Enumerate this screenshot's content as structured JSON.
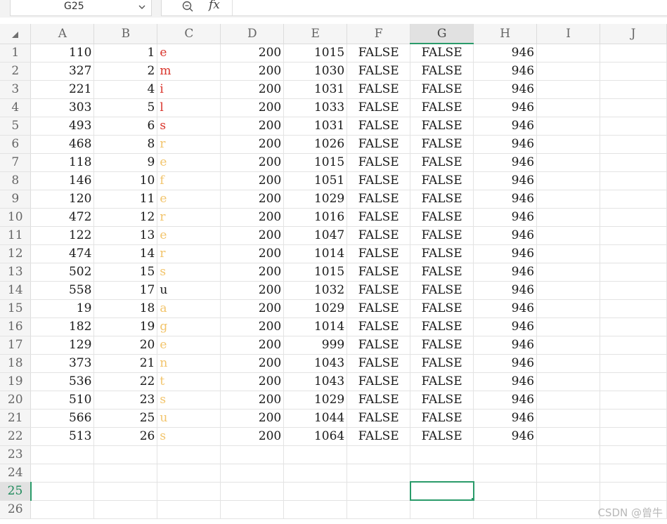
{
  "formula_bar": {
    "name_box": "G25",
    "fx_label": "fx",
    "formula_value": ""
  },
  "columns": [
    "A",
    "B",
    "C",
    "D",
    "E",
    "F",
    "G",
    "H",
    "I",
    "J"
  ],
  "selected_column": "G",
  "selected_row": 25,
  "rows": [
    {
      "row": 1,
      "A": "110",
      "B": "1",
      "C": "e",
      "D": "200",
      "E": "1015",
      "F": "FALSE",
      "G": "FALSE",
      "H": "946"
    },
    {
      "row": 2,
      "A": "327",
      "B": "2",
      "C": "m",
      "D": "200",
      "E": "1030",
      "F": "FALSE",
      "G": "FALSE",
      "H": "946"
    },
    {
      "row": 3,
      "A": "221",
      "B": "4",
      "C": "i",
      "D": "200",
      "E": "1031",
      "F": "FALSE",
      "G": "FALSE",
      "H": "946"
    },
    {
      "row": 4,
      "A": "303",
      "B": "5",
      "C": "l",
      "D": "200",
      "E": "1033",
      "F": "FALSE",
      "G": "FALSE",
      "H": "946"
    },
    {
      "row": 5,
      "A": "493",
      "B": "6",
      "C": "s",
      "D": "200",
      "E": "1031",
      "F": "FALSE",
      "G": "FALSE",
      "H": "946"
    },
    {
      "row": 6,
      "A": "468",
      "B": "8",
      "C": "r",
      "D": "200",
      "E": "1026",
      "F": "FALSE",
      "G": "FALSE",
      "H": "946"
    },
    {
      "row": 7,
      "A": "118",
      "B": "9",
      "C": "e",
      "D": "200",
      "E": "1015",
      "F": "FALSE",
      "G": "FALSE",
      "H": "946"
    },
    {
      "row": 8,
      "A": "146",
      "B": "10",
      "C": "f",
      "D": "200",
      "E": "1051",
      "F": "FALSE",
      "G": "FALSE",
      "H": "946"
    },
    {
      "row": 9,
      "A": "120",
      "B": "11",
      "C": "e",
      "D": "200",
      "E": "1029",
      "F": "FALSE",
      "G": "FALSE",
      "H": "946"
    },
    {
      "row": 10,
      "A": "472",
      "B": "12",
      "C": "r",
      "D": "200",
      "E": "1016",
      "F": "FALSE",
      "G": "FALSE",
      "H": "946"
    },
    {
      "row": 11,
      "A": "122",
      "B": "13",
      "C": "e",
      "D": "200",
      "E": "1047",
      "F": "FALSE",
      "G": "FALSE",
      "H": "946"
    },
    {
      "row": 12,
      "A": "474",
      "B": "14",
      "C": "r",
      "D": "200",
      "E": "1014",
      "F": "FALSE",
      "G": "FALSE",
      "H": "946"
    },
    {
      "row": 13,
      "A": "502",
      "B": "15",
      "C": "s",
      "D": "200",
      "E": "1015",
      "F": "FALSE",
      "G": "FALSE",
      "H": "946"
    },
    {
      "row": 14,
      "A": "558",
      "B": "17",
      "C": "u",
      "D": "200",
      "E": "1032",
      "F": "FALSE",
      "G": "FALSE",
      "H": "946"
    },
    {
      "row": 15,
      "A": "19",
      "B": "18",
      "C": "a",
      "D": "200",
      "E": "1029",
      "F": "FALSE",
      "G": "FALSE",
      "H": "946"
    },
    {
      "row": 16,
      "A": "182",
      "B": "19",
      "C": "g",
      "D": "200",
      "E": "1014",
      "F": "FALSE",
      "G": "FALSE",
      "H": "946"
    },
    {
      "row": 17,
      "A": "129",
      "B": "20",
      "C": "e",
      "D": "200",
      "E": "999",
      "F": "FALSE",
      "G": "FALSE",
      "H": "946"
    },
    {
      "row": 18,
      "A": "373",
      "B": "21",
      "C": "n",
      "D": "200",
      "E": "1043",
      "F": "FALSE",
      "G": "FALSE",
      "H": "946"
    },
    {
      "row": 19,
      "A": "536",
      "B": "22",
      "C": "t",
      "D": "200",
      "E": "1043",
      "F": "FALSE",
      "G": "FALSE",
      "H": "946"
    },
    {
      "row": 20,
      "A": "510",
      "B": "23",
      "C": "s",
      "D": "200",
      "E": "1029",
      "F": "FALSE",
      "G": "FALSE",
      "H": "946"
    },
    {
      "row": 21,
      "A": "566",
      "B": "25",
      "C": "u",
      "D": "200",
      "E": "1044",
      "F": "FALSE",
      "G": "FALSE",
      "H": "946"
    },
    {
      "row": 22,
      "A": "513",
      "B": "26",
      "C": "s",
      "D": "200",
      "E": "1064",
      "F": "FALSE",
      "G": "FALSE",
      "H": "946"
    },
    {
      "row": 23
    },
    {
      "row": 24
    },
    {
      "row": 25
    },
    {
      "row": 26
    }
  ],
  "c_colors": [
    "#d9342b",
    "#d9342b",
    "#d9342b",
    "#d9342b",
    "#d9342b",
    "#f2c46b",
    "#f2c46b",
    "#f2c46b",
    "#f2c46b",
    "#f2c46b",
    "#f2c46b",
    "#f2c46b",
    "#f2c46b",
    "#1a1a1a",
    "#f2c46b",
    "#f2c46b",
    "#f2c46b",
    "#f2c46b",
    "#f2c46b",
    "#f2c46b",
    "#f2c46b",
    "#f2c46b"
  ],
  "watermark": "CSDN @曾牛"
}
